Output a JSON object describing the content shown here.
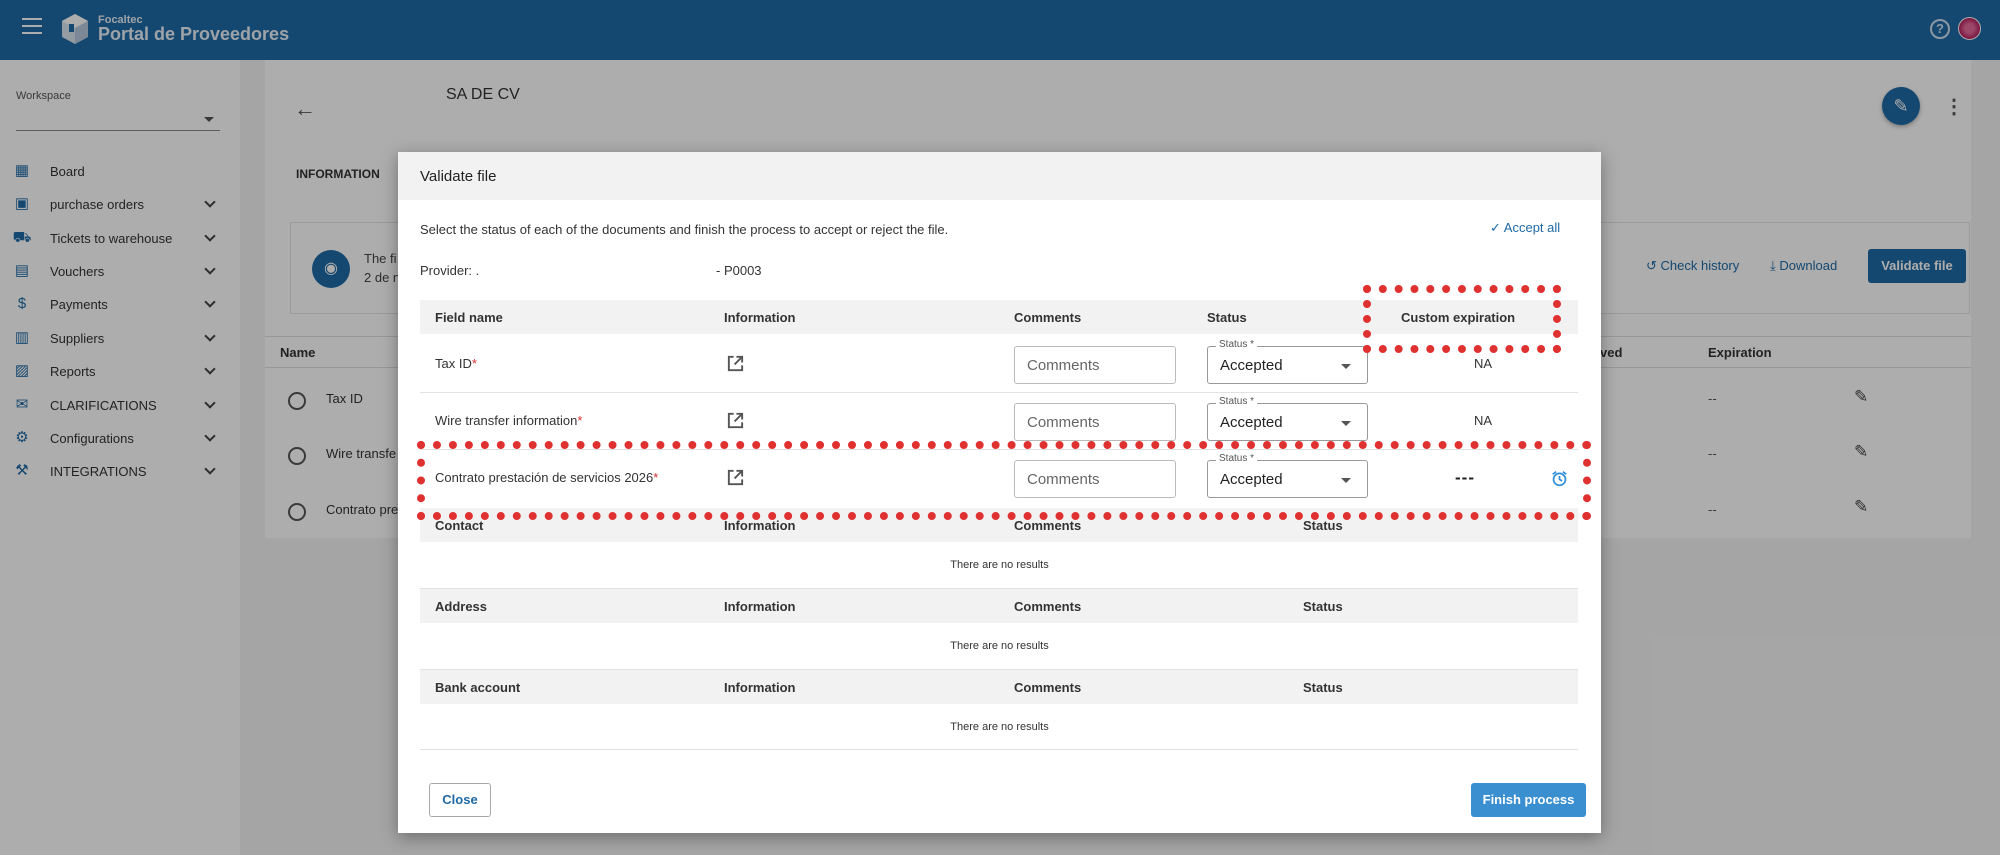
{
  "app": {
    "brand_small": "Focaltec",
    "brand_title": "Portal de Proveedores",
    "help_glyph": "?"
  },
  "sidebar": {
    "workspace_label": "Workspace",
    "workspace_value": "",
    "items": [
      {
        "label": "Board",
        "icon": "dashboard-icon"
      },
      {
        "label": "purchase orders",
        "icon": "cart-icon"
      },
      {
        "label": "Tickets to warehouse",
        "icon": "truck-icon"
      },
      {
        "label": "Vouchers",
        "icon": "document-icon"
      },
      {
        "label": "Payments",
        "icon": "dollar-icon"
      },
      {
        "label": "Suppliers",
        "icon": "building-icon"
      },
      {
        "label": "Reports",
        "icon": "chart-icon"
      },
      {
        "label": "CLARIFICATIONS",
        "icon": "mail-icon"
      },
      {
        "label": "Configurations",
        "icon": "gear-icon"
      },
      {
        "label": "INTEGRATIONS",
        "icon": "integration-icon"
      }
    ]
  },
  "page": {
    "company_name": "SA DE CV",
    "tab_information": "INFORMATION",
    "info_text_1": "The fi",
    "info_text_2": "2 de n",
    "check_history": "Check history",
    "download": "Download",
    "validate_file": "Validate file",
    "table_headers": {
      "name": "Name",
      "approved": "ved",
      "expiration": "Expiration"
    },
    "rows": [
      {
        "name": "Tax ID",
        "expiration": "--"
      },
      {
        "name": "Wire transfe",
        "expiration": "--"
      },
      {
        "name": "Contrato pre",
        "expiration": "--"
      }
    ]
  },
  "dialog": {
    "title": "Validate file",
    "instructions": "Select the status of each of the documents and finish the process to accept or reject the file.",
    "accept_all": "Accept all",
    "provider_label": "Provider: .",
    "provider_code": "- P0003",
    "fields_table": {
      "headers": {
        "field_name": "Field name",
        "information": "Information",
        "comments": "Comments",
        "status": "Status",
        "custom_expiration": "Custom expiration"
      },
      "rows": [
        {
          "label": "Tax ID",
          "required": "*",
          "comments_placeholder": "Comments",
          "status_legend": "Status *",
          "status": "Accepted",
          "expiration": "NA"
        },
        {
          "label": "Wire transfer information",
          "required": "*",
          "comments_placeholder": "Comments",
          "status_legend": "Status *",
          "status": "Accepted",
          "expiration": "NA"
        },
        {
          "label": "Contrato prestación de servicios 2026",
          "required": "*",
          "comments_placeholder": "Comments",
          "status_legend": "Status *",
          "status": "Accepted",
          "expiration": "---"
        }
      ]
    },
    "contact_table": {
      "headers": {
        "name": "Contact",
        "information": "Information",
        "comments": "Comments",
        "status": "Status"
      },
      "empty": "There are no results"
    },
    "address_table": {
      "headers": {
        "name": "Address",
        "information": "Information",
        "comments": "Comments",
        "status": "Status"
      },
      "empty": "There are no results"
    },
    "bank_table": {
      "headers": {
        "name": "Bank account",
        "information": "Information",
        "comments": "Comments",
        "status": "Status"
      },
      "empty": "There are no results"
    },
    "close_label": "Close",
    "finish_label": "Finish process"
  },
  "colors": {
    "topbar": "#1f6aa5",
    "accent": "#1f6aa5",
    "highlight": "#e03131",
    "required": "#d32f2f"
  }
}
